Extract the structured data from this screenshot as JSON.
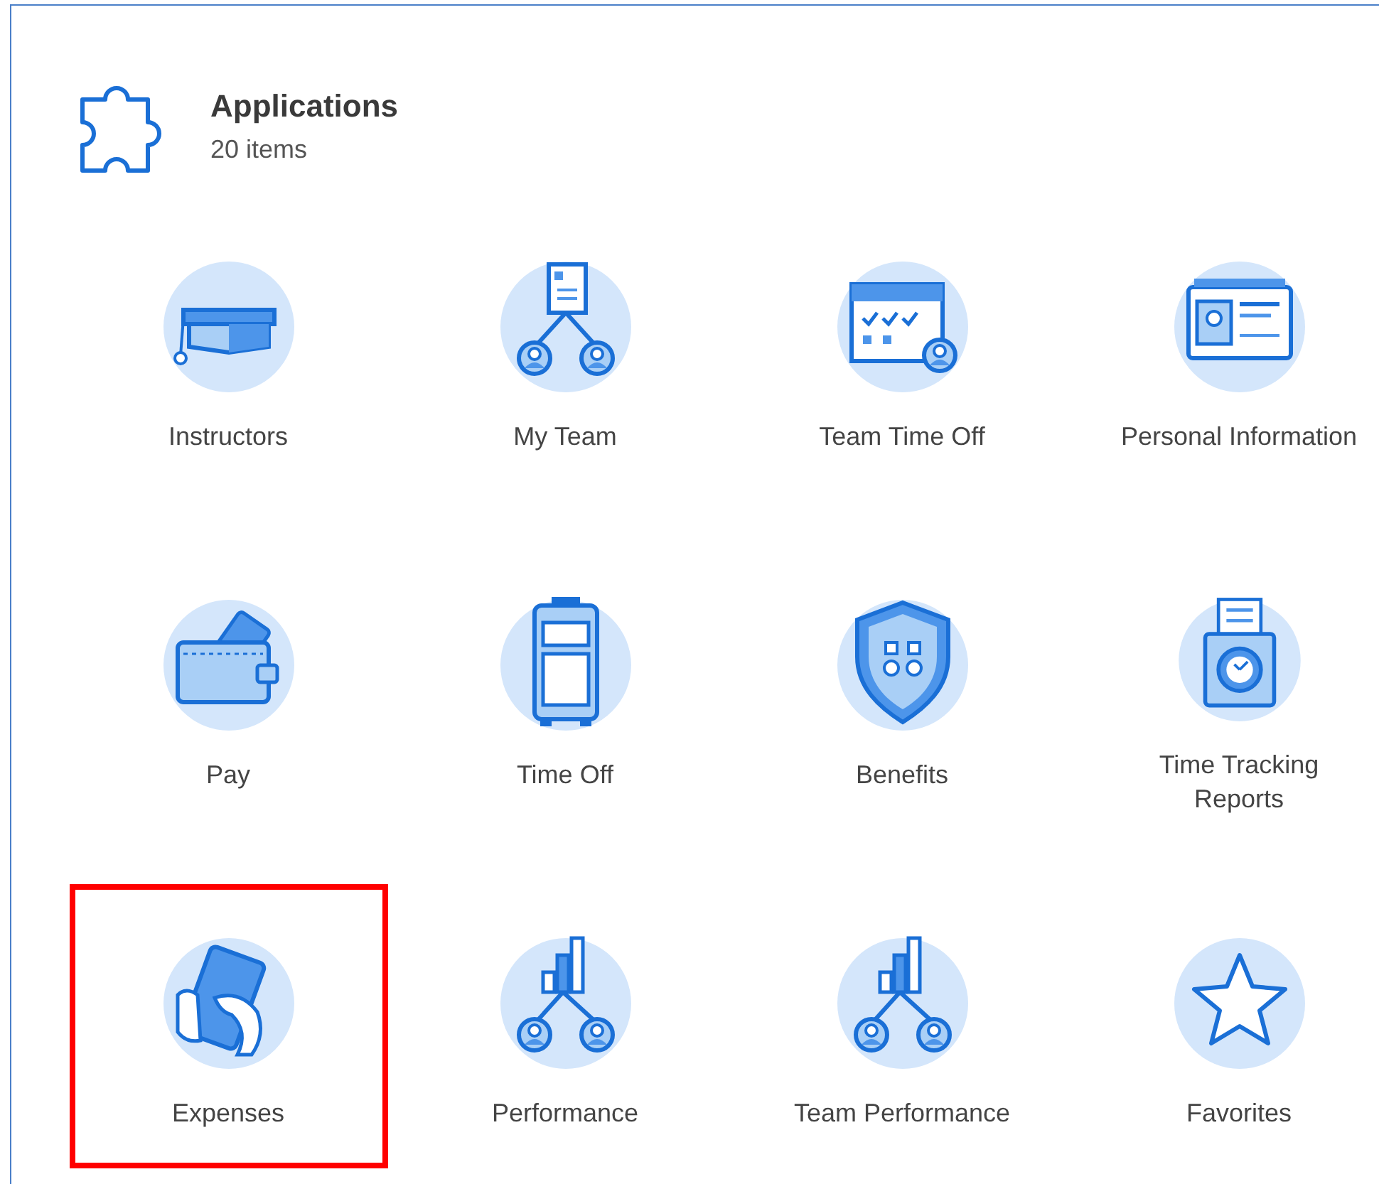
{
  "header": {
    "title": "Applications",
    "count": "20 items"
  },
  "apps": [
    {
      "label": "Instructors",
      "kind": "cap",
      "highlighted": false
    },
    {
      "label": "My Team",
      "kind": "team",
      "highlighted": false
    },
    {
      "label": "Team Time Off",
      "kind": "calendar",
      "highlighted": false
    },
    {
      "label": "Personal Information",
      "kind": "idcard",
      "highlighted": false
    },
    {
      "label": "Pay",
      "kind": "wallet",
      "highlighted": false
    },
    {
      "label": "Time Off",
      "kind": "suitcase",
      "highlighted": false
    },
    {
      "label": "Benefits",
      "kind": "shield",
      "highlighted": false
    },
    {
      "label": "Time Tracking Reports",
      "kind": "clock",
      "highlighted": false
    },
    {
      "label": "Expenses",
      "kind": "money",
      "highlighted": true
    },
    {
      "label": "Performance",
      "kind": "chartteam",
      "highlighted": false
    },
    {
      "label": "Team Performance",
      "kind": "chartteam",
      "highlighted": false
    },
    {
      "label": "Favorites",
      "kind": "star",
      "highlighted": false
    }
  ]
}
